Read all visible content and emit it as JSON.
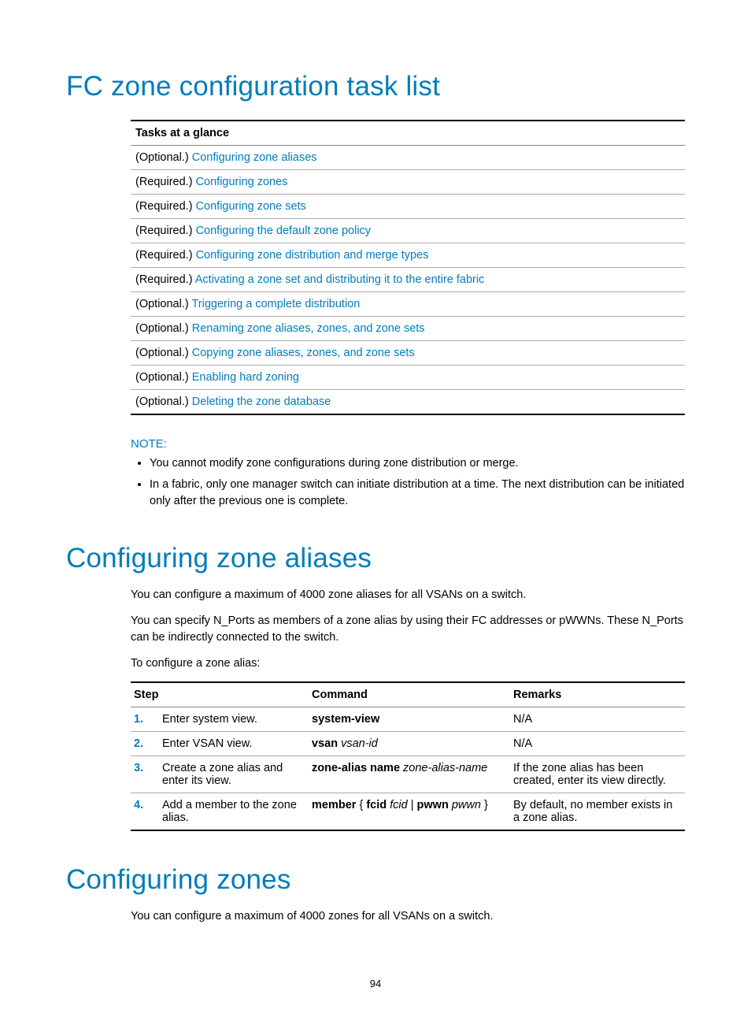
{
  "headings": {
    "h1": "FC zone configuration task list",
    "h2": "Configuring zone aliases",
    "h3": "Configuring zones"
  },
  "tasks": {
    "header": "Tasks at a glance",
    "rows": [
      {
        "prefix": "(Optional.) ",
        "link": "Configuring zone aliases"
      },
      {
        "prefix": "(Required.) ",
        "link": "Configuring zones"
      },
      {
        "prefix": "(Required.) ",
        "link": "Configuring zone sets"
      },
      {
        "prefix": "(Required.) ",
        "link": "Configuring the default zone policy"
      },
      {
        "prefix": "(Required.) ",
        "link": "Configuring zone distribution and merge types"
      },
      {
        "prefix": "(Required.) ",
        "link": "Activating a zone set and distributing it to the entire fabric"
      },
      {
        "prefix": "(Optional.) ",
        "link": "Triggering a complete distribution"
      },
      {
        "prefix": "(Optional.) ",
        "link": "Renaming zone aliases, zones, and zone sets"
      },
      {
        "prefix": "(Optional.) ",
        "link": "Copying zone aliases, zones, and zone sets"
      },
      {
        "prefix": "(Optional.) ",
        "link": "Enabling hard zoning"
      },
      {
        "prefix": "(Optional.) ",
        "link": "Deleting the zone database"
      }
    ]
  },
  "note": {
    "title": "NOTE:",
    "items": [
      "You cannot modify zone configurations during zone distribution or merge.",
      "In a fabric, only one manager switch can initiate distribution at a time. The next distribution can be initiated only after the previous one is complete."
    ]
  },
  "aliases": {
    "p1": "You can configure a maximum of 4000 zone aliases for all VSANs on a switch.",
    "p2": "You can specify N_Ports as members of a zone alias by using their FC addresses or pWWNs. These N_Ports can be indirectly connected to the switch.",
    "p3": "To configure a zone alias:"
  },
  "steps": {
    "headers": {
      "step": "Step",
      "command": "Command",
      "remarks": "Remarks"
    },
    "rows": [
      {
        "num": "1.",
        "desc": "Enter system view.",
        "cmd": [
          {
            "b": "system-view"
          }
        ],
        "remarks": "N/A"
      },
      {
        "num": "2.",
        "desc": "Enter VSAN view.",
        "cmd": [
          {
            "b": "vsan"
          },
          {
            "t": " "
          },
          {
            "i": "vsan-id"
          }
        ],
        "remarks": "N/A"
      },
      {
        "num": "3.",
        "desc": "Create a zone alias and enter its view.",
        "cmd": [
          {
            "b": "zone-alias name"
          },
          {
            "t": " "
          },
          {
            "i": "zone-alias-name"
          }
        ],
        "remarks": "If the zone alias has been created, enter its view directly."
      },
      {
        "num": "4.",
        "desc": "Add a member to the zone alias.",
        "cmd": [
          {
            "b": "member"
          },
          {
            "t": " { "
          },
          {
            "b": "fcid"
          },
          {
            "t": " "
          },
          {
            "i": "fcid"
          },
          {
            "t": " | "
          },
          {
            "b": "pwwn"
          },
          {
            "t": " "
          },
          {
            "i": "pwwn"
          },
          {
            "t": " }"
          }
        ],
        "remarks": "By default, no member exists in a zone alias."
      }
    ]
  },
  "zones": {
    "p1": "You can configure a maximum of 4000 zones for all VSANs on a switch."
  },
  "page_number": "94"
}
